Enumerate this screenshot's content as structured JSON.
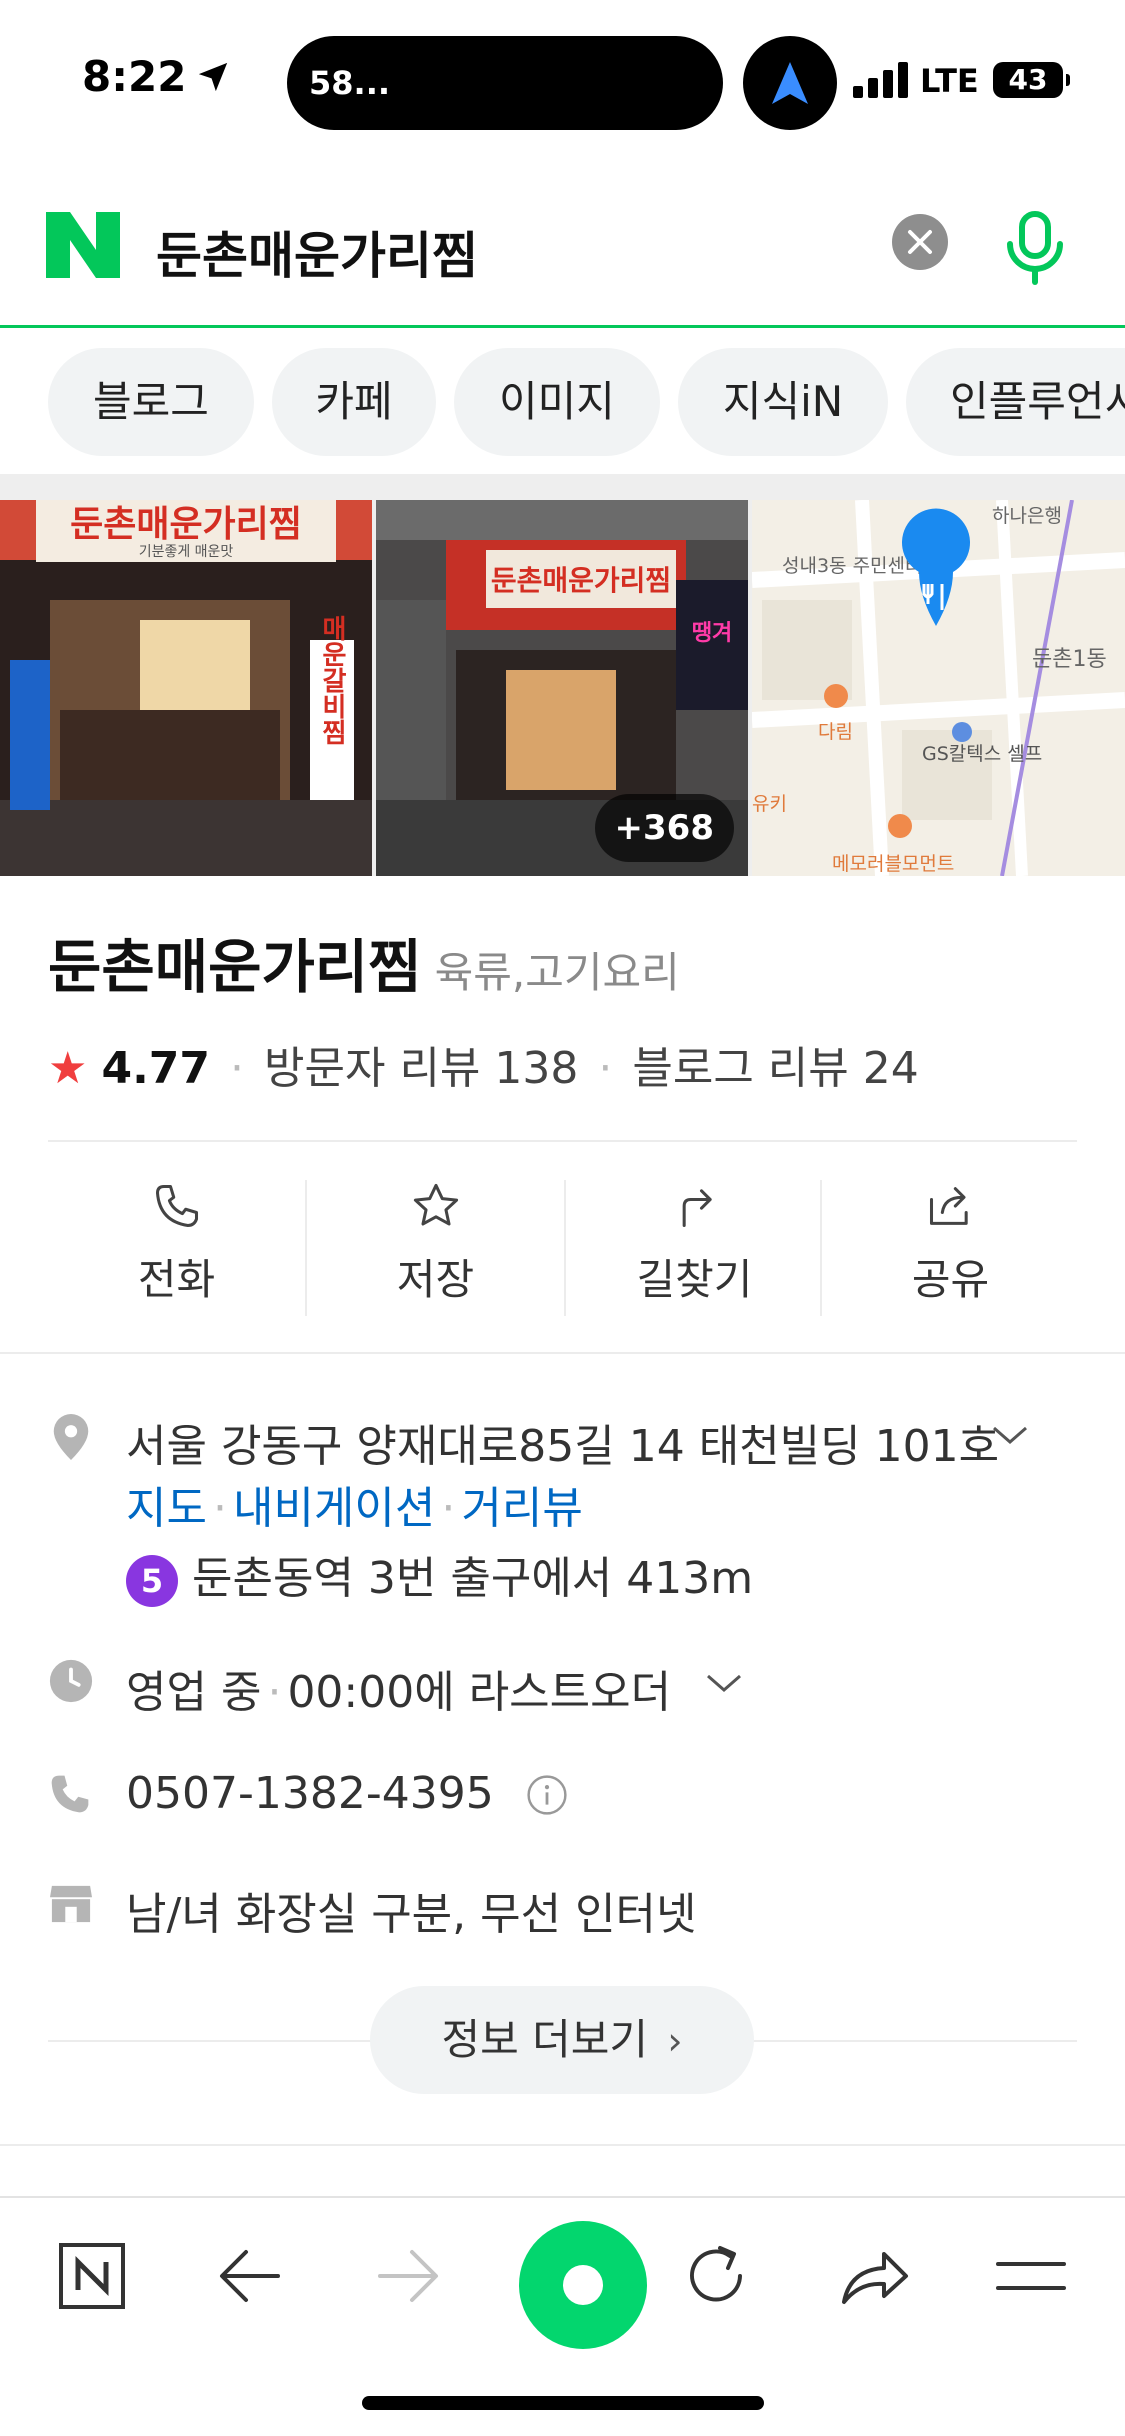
{
  "status_bar": {
    "time": "8:22",
    "island_text": "58...",
    "network": "LTE",
    "battery": "43"
  },
  "search": {
    "query": "둔촌매운가리찜",
    "logo_letter": "N",
    "brand_color": "#03c75a"
  },
  "tabs": [
    "블로그",
    "카페",
    "이미지",
    "지식iN",
    "인플루언서"
  ],
  "gallery": {
    "photo_count": "+368",
    "sign_text": "둔촌매운가리찜",
    "sign_sub": "기분좋게 매운맛",
    "side_sign": "매운갈비찜",
    "map_labels": {
      "bank": "하나은행",
      "center": "성내3동 주민센터",
      "dong": "둔촌1동",
      "darim": "다림",
      "gas": "GS칼텍스 셀프",
      "cafe": "메모러블모먼트",
      "yuki": "유키"
    }
  },
  "place": {
    "name": "둔촌매운가리찜",
    "category": "육류,고기요리",
    "rating": "4.77",
    "visitor_reviews": "방문자 리뷰 138",
    "blog_reviews": "블로그 리뷰 24"
  },
  "actions": {
    "call": "전화",
    "save": "저장",
    "directions": "길찾기",
    "share": "공유"
  },
  "info": {
    "address": "서울 강동구 양재대로85길 14 태천빌딩 101호",
    "links": [
      "지도",
      "내비게이션",
      "거리뷰"
    ],
    "subway_line": "5",
    "subway_text": "둔촌동역 3번 출구에서 413m",
    "hours_status": "영업 중",
    "hours_detail": "00:00에 라스트오더",
    "phone": "0507-1382-4395",
    "amenities": "남/녀 화장실 구분, 무선 인터넷",
    "more_button": "정보 더보기"
  }
}
